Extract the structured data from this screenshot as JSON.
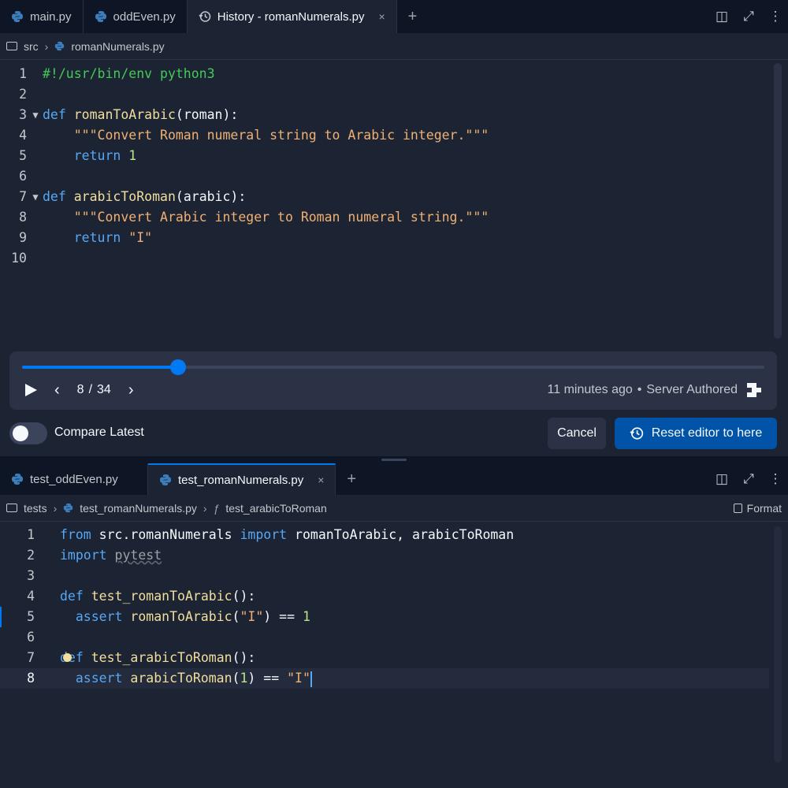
{
  "top_tabs": [
    {
      "label": "main.py",
      "icon": "python-icon",
      "active": false
    },
    {
      "label": "oddEven.py",
      "icon": "python-icon",
      "active": false
    },
    {
      "label": "History - romanNumerals.py",
      "icon": "history-icon",
      "active": true,
      "close": "×"
    }
  ],
  "tab_add": "+",
  "top_breadcrumb": {
    "folder": "src",
    "file": "romanNumerals.py"
  },
  "top_code": [
    {
      "n": "1"
    },
    {
      "n": "2"
    },
    {
      "n": "3",
      "fold": "▼"
    },
    {
      "n": "4"
    },
    {
      "n": "5"
    },
    {
      "n": "6"
    },
    {
      "n": "7",
      "fold": "▼"
    },
    {
      "n": "8"
    },
    {
      "n": "9"
    },
    {
      "n": "10"
    }
  ],
  "top_code_text": {
    "l1": "#!/usr/bin/env python3",
    "l3_kw": "def ",
    "l3_fn": "romanToArabic",
    "l3_rest": "(roman):",
    "l4_str": "    \"\"\"Convert Roman numeral string to Arabic integer.\"\"\"",
    "l5_kw": "    return ",
    "l5_num": "1",
    "l7_kw": "def ",
    "l7_fn": "arabicToRoman",
    "l7_rest": "(arabic):",
    "l8_str": "    \"\"\"Convert Arabic integer to Roman numeral string.\"\"\"",
    "l9_kw": "    return ",
    "l9_str": "\"I\""
  },
  "history": {
    "position": "8",
    "separator": "/",
    "total": "34",
    "progress_fraction": 0.21,
    "time": "11 minutes ago",
    "dot": "•",
    "author": "Server Authored",
    "prev": "‹",
    "next": "›"
  },
  "compare": {
    "label": "Compare Latest",
    "on": false
  },
  "buttons": {
    "cancel": "Cancel",
    "reset": "Reset editor to here"
  },
  "bottom_tabs": [
    {
      "label": "test_oddEven.py",
      "icon": "python-icon",
      "active": false
    },
    {
      "label": "test_romanNumerals.py",
      "icon": "python-icon",
      "active": true,
      "close": "×"
    }
  ],
  "bottom_breadcrumb": {
    "folder": "tests",
    "file": "test_romanNumerals.py",
    "func_icon": "ƒ",
    "func": "test_arabicToRoman",
    "format": "Format"
  },
  "bottom_code_text": {
    "l1_kw1": "from ",
    "l1_mid": "src.romanNumerals ",
    "l1_kw2": "import ",
    "l1_rest": "romanToArabic, arabicToRoman",
    "l2_kw": "import ",
    "l2_mod": "pytest",
    "l4_kw": "def ",
    "l4_fn": "test_romanToArabic",
    "l4_rest": "():",
    "l5_kw": "  assert ",
    "l5_fn": "romanToArabic",
    "l5_a": "(",
    "l5_str": "\"I\"",
    "l5_b": ") == ",
    "l5_num": "1",
    "l7_kw": "def ",
    "l7_fn": "test_arabicToRoman",
    "l7_rest": "():",
    "l8_kw": "  assert ",
    "l8_fn": "arabicToRoman",
    "l8_a": "(",
    "l8_num": "1",
    "l8_b": ") == ",
    "l8_str": "\"I\""
  },
  "bottom_line_numbers": [
    "1",
    "2",
    "3",
    "4",
    "5",
    "6",
    "7",
    "8"
  ],
  "colors": {
    "accent": "#0079f2",
    "reset_button": "#0053a6",
    "background": "#1c2333"
  }
}
